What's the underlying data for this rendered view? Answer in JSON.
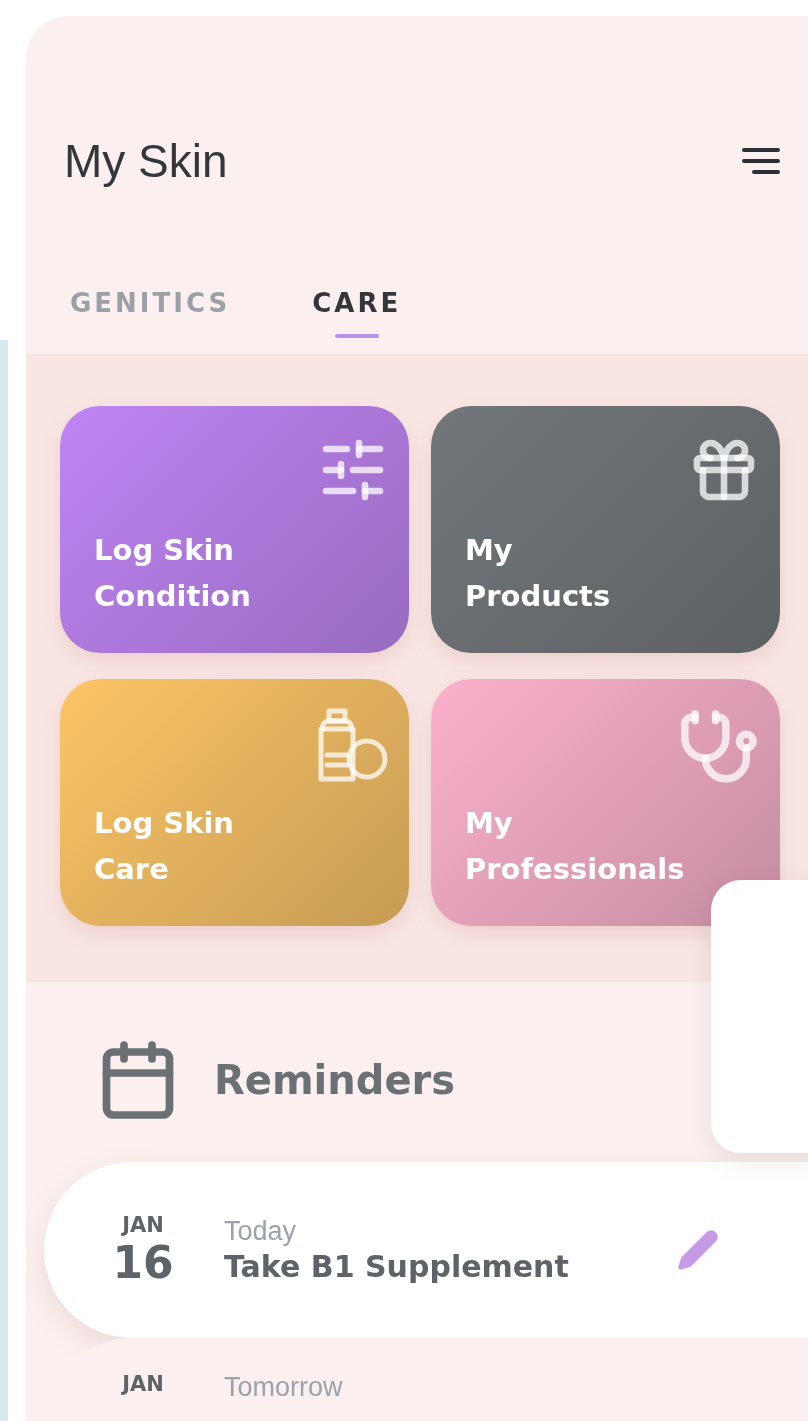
{
  "header": {
    "title": "My Skin"
  },
  "tabs": [
    {
      "label": "GENITICS",
      "selected": false
    },
    {
      "label": "CARE",
      "selected": true
    }
  ],
  "tiles": [
    {
      "label": "Log Skin Condition",
      "color": "#c084f5"
    },
    {
      "label": "My Products",
      "color": "#72777b"
    },
    {
      "label": "Log Skin Care",
      "color": "#fdc566"
    },
    {
      "label": "My Professionals",
      "color": "#fcb1cd"
    }
  ],
  "reminders": {
    "title": "Reminders",
    "items": [
      {
        "month": "JAN",
        "day": "16",
        "when": "Today",
        "task": "Take B1 Supplement"
      },
      {
        "month": "JAN",
        "when": "Tomorrow"
      }
    ]
  }
}
